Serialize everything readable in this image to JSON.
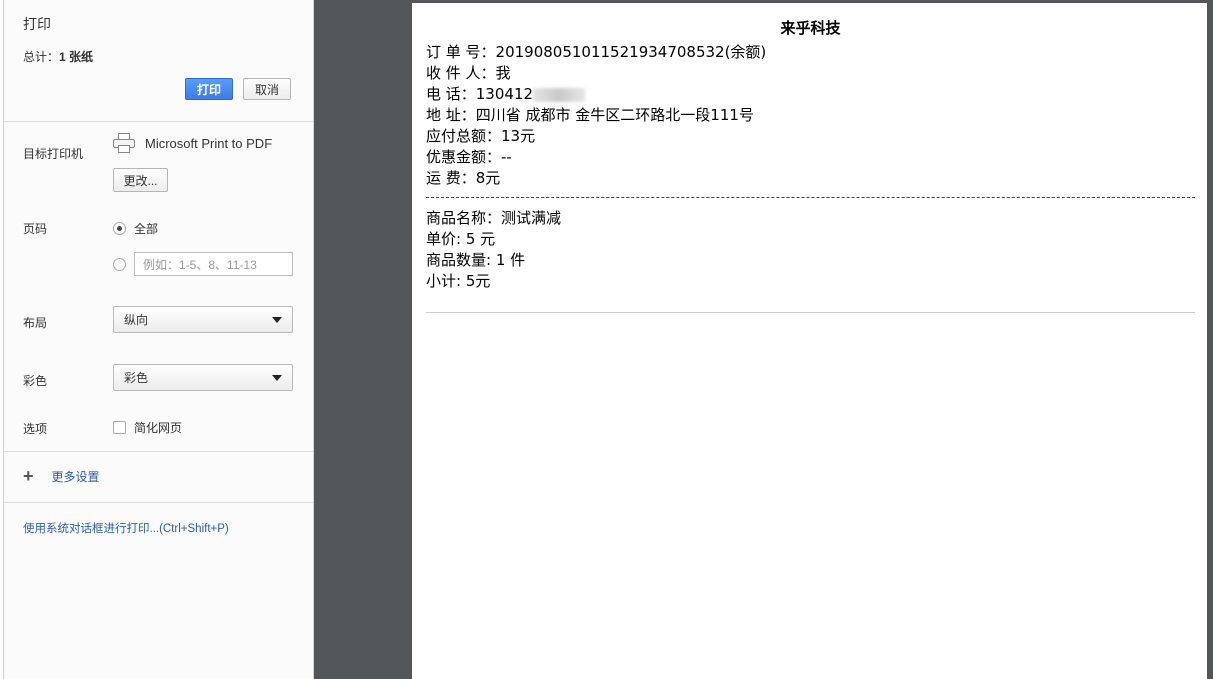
{
  "sidebar": {
    "title": "打印",
    "total_prefix": "总计：",
    "total_value": "1 张纸",
    "print_button": "打印",
    "cancel_button": "取消",
    "destination": {
      "label": "目标打印机",
      "printer_name": "Microsoft Print to PDF",
      "change_button": "更改..."
    },
    "pages": {
      "label": "页码",
      "all_option": "全部",
      "range_placeholder": "例如：1-5、8、11-13"
    },
    "layout": {
      "label": "布局",
      "value": "纵向"
    },
    "color": {
      "label": "彩色",
      "value": "彩色"
    },
    "options": {
      "label": "选项",
      "simplify": "简化网页"
    },
    "more_settings": "更多设置",
    "system_dialog_link": "使用系统对话框进行打印...(Ctrl+Shift+P)"
  },
  "preview": {
    "title": "来乎科技",
    "order_line": "订 单 号：2019080510115219347085 32(余额)",
    "order_label": "订 单 号：",
    "order_value": "20190805101152193470853 2(余额)",
    "receiver": "收 件 人：我",
    "phone_prefix": "电      话：130412",
    "address": "地      址：四川省 成都市 金牛区二环路北一段111号",
    "payable": "应付总额：13元",
    "discount": "优惠金额：--",
    "shipping": "运      费：8元",
    "product_name": "商品名称：测试满减",
    "unit_price": "单价: 5 元",
    "quantity": "商品数量: 1 件",
    "subtotal": "小计: 5元"
  },
  "colors": {
    "primary_button": "#3d7ce9",
    "link": "#2a5db0",
    "preview_background": "#525659"
  },
  "icons": [
    "printer-icon",
    "plus-icon",
    "chevron-down-icon"
  ]
}
